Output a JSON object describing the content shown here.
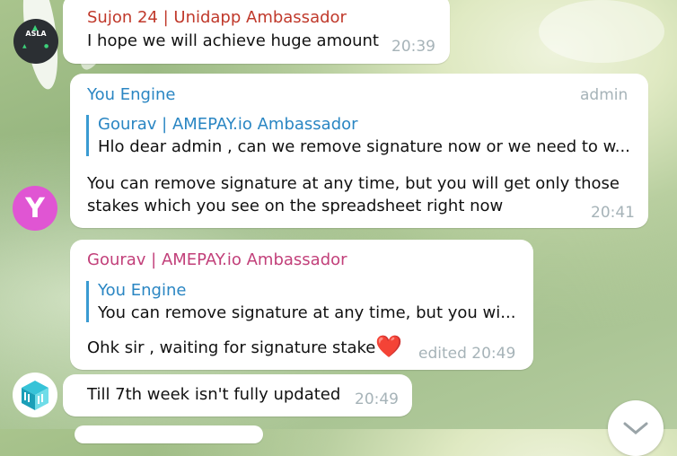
{
  "messages": [
    {
      "sender": "Sujon 24 | Unidapp Ambassador",
      "text": "I hope we will achieve huge amount",
      "time": "20:39",
      "avatar_text": "ASLA"
    },
    {
      "sender": "You Engine",
      "role": "admin",
      "reply_to_name": "Gourav | AMEPAY.io Ambassador",
      "reply_to_text": "Hlo dear admin , can we remove signature now or we need to w...",
      "text_line1": "You can remove signature at any time, but you will get only those",
      "text_line2": "stakes which you see on the spreadsheet right now",
      "time": "20:41",
      "avatar_text": "Y"
    },
    {
      "sender": "Gourav | AMEPAY.io Ambassador",
      "reply_to_name": "You Engine",
      "reply_to_text": "You can remove signature at any time, but you wi...",
      "text": "Ohk sir , waiting for signature stake",
      "emoji": "❤️",
      "time": "edited 20:49"
    },
    {
      "text": "Till 7th week isn't fully updated",
      "time": "20:49"
    }
  ],
  "colors": {
    "sender_sujon": "#c0392b",
    "sender_you_engine": "#2a86c3",
    "sender_gourav": "#c2407a",
    "reply_bar": "#3a9bd2",
    "you_engine_avatar": "#e055d3"
  }
}
